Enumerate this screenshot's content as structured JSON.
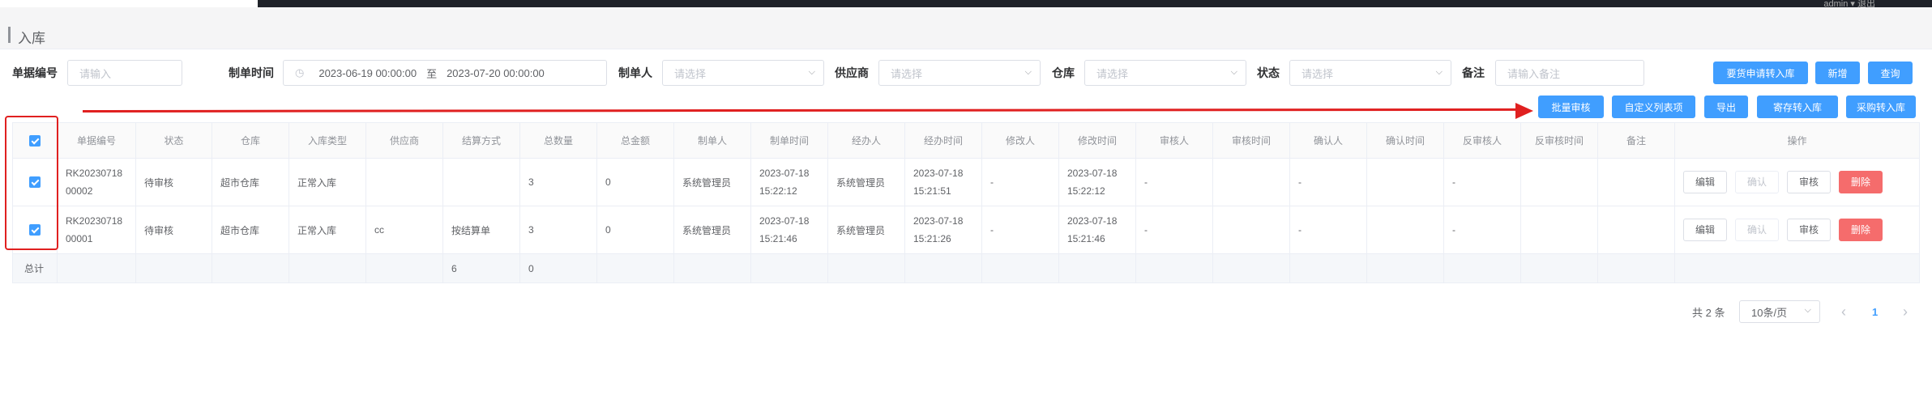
{
  "header": {
    "title": "入库",
    "user_text": "admin ▾ 退出"
  },
  "filters": {
    "doc_no": {
      "label": "单据编号",
      "placeholder": "请输入"
    },
    "date": {
      "label": "制单时间",
      "start": "2023-06-19 00:00:00",
      "sep": "至",
      "end": "2023-07-20 00:00:00"
    },
    "maker": {
      "label": "制单人",
      "placeholder": "请选择"
    },
    "supplier": {
      "label": "供应商",
      "placeholder": "请选择"
    },
    "warehouse": {
      "label": "仓库",
      "placeholder": "请选择"
    },
    "status": {
      "label": "状态",
      "placeholder": "请选择"
    },
    "remark": {
      "label": "备注",
      "placeholder": "请输入备注"
    }
  },
  "top_buttons": {
    "apply": "要货申请转入库",
    "add": "新增",
    "query": "查询"
  },
  "toolbar": {
    "batch_audit": "批量审核",
    "custom_cols": "自定义列表项",
    "export": "导出",
    "consign": "寄存转入库",
    "purchase": "采购转入库"
  },
  "table": {
    "headers": [
      "单据编号",
      "状态",
      "仓库",
      "入库类型",
      "供应商",
      "结算方式",
      "总数量",
      "总金额",
      "制单人",
      "制单时间",
      "经办人",
      "经办时间",
      "修改人",
      "修改时间",
      "审核人",
      "审核时间",
      "确认人",
      "确认时间",
      "反审核人",
      "反审核时间",
      "备注",
      "操作"
    ],
    "rows": [
      {
        "doc_no": "RK2023071800002",
        "status": "待审核",
        "warehouse": "超市仓库",
        "type": "正常入库",
        "supplier": "",
        "settle": "",
        "qty": "3",
        "amount": "0",
        "maker": "系统管理员",
        "make_time": "2023-07-18 15:22:12",
        "handler": "系统管理员",
        "handle_time": "2023-07-18 15:21:51",
        "modifier": "-",
        "modify_time": "2023-07-18 15:22:12",
        "auditor": "-",
        "audit_time": "",
        "confirmer": "-",
        "confirm_time": "",
        "unauditor": "-",
        "unaudit_time": "",
        "remark": ""
      },
      {
        "doc_no": "RK2023071800001",
        "status": "待审核",
        "warehouse": "超市仓库",
        "type": "正常入库",
        "supplier": "cc",
        "settle": "按结算单",
        "qty": "3",
        "amount": "0",
        "maker": "系统管理员",
        "make_time": "2023-07-18 15:21:46",
        "handler": "系统管理员",
        "handle_time": "2023-07-18 15:21:26",
        "modifier": "-",
        "modify_time": "2023-07-18 15:21:46",
        "auditor": "-",
        "audit_time": "",
        "confirmer": "-",
        "confirm_time": "",
        "unauditor": "-",
        "unaudit_time": "",
        "remark": ""
      }
    ],
    "ops": {
      "edit": "编辑",
      "confirm": "确认",
      "audit": "审核",
      "delete": "删除"
    },
    "summary": {
      "label": "总计",
      "qty": "6",
      "amount": "0"
    }
  },
  "pagination": {
    "total": "共 2 条",
    "page_size": "10条/页",
    "prev": "‹",
    "current": "1",
    "next": "›"
  },
  "colors": {
    "primary": "#409eff",
    "danger": "#f56c6c",
    "annotation": "#e02020"
  }
}
